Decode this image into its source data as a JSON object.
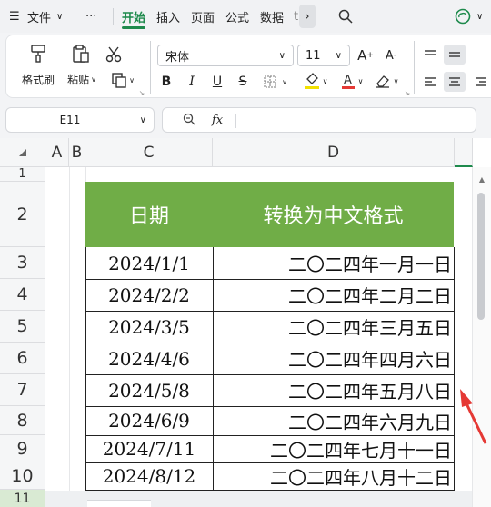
{
  "menu": {
    "file_label": "文件",
    "more_label": "···",
    "tabs": [
      "开始",
      "插入",
      "页面",
      "公式",
      "数据"
    ],
    "overflow_label": "t"
  },
  "ribbon": {
    "format_painter": "格式刷",
    "paste": "粘贴",
    "font_name": "宋体",
    "font_size": "11",
    "bold": "B",
    "italic": "I",
    "underline": "U",
    "strike": "S"
  },
  "formula_bar": {
    "cell_ref": "E11",
    "fx": "fx",
    "content": ""
  },
  "sheet": {
    "columns": [
      "A",
      "B",
      "C",
      "D"
    ],
    "rows": [
      "1",
      "2",
      "3",
      "4",
      "5",
      "6",
      "7",
      "8",
      "9",
      "10",
      "11"
    ],
    "header": [
      "日期",
      "转换为中文格式"
    ],
    "data": [
      [
        "2024/1/1",
        "二〇二四年一月一日"
      ],
      [
        "2024/2/2",
        "二〇二四年二月二日"
      ],
      [
        "2024/3/5",
        "二〇二四年三月五日"
      ],
      [
        "2024/4/6",
        "二〇二四年四月六日"
      ],
      [
        "2024/5/8",
        "二〇二四年五月八日"
      ],
      [
        "2024/6/9",
        "二〇二四年六月九日"
      ],
      [
        "2024/7/11",
        "二〇二四年七月十一日"
      ],
      [
        "2024/8/12",
        "二〇二四年八月十二日"
      ]
    ]
  },
  "colors": {
    "header_fill": "#70ad47",
    "accent": "#1e8a4c",
    "arrow": "#e53935"
  }
}
